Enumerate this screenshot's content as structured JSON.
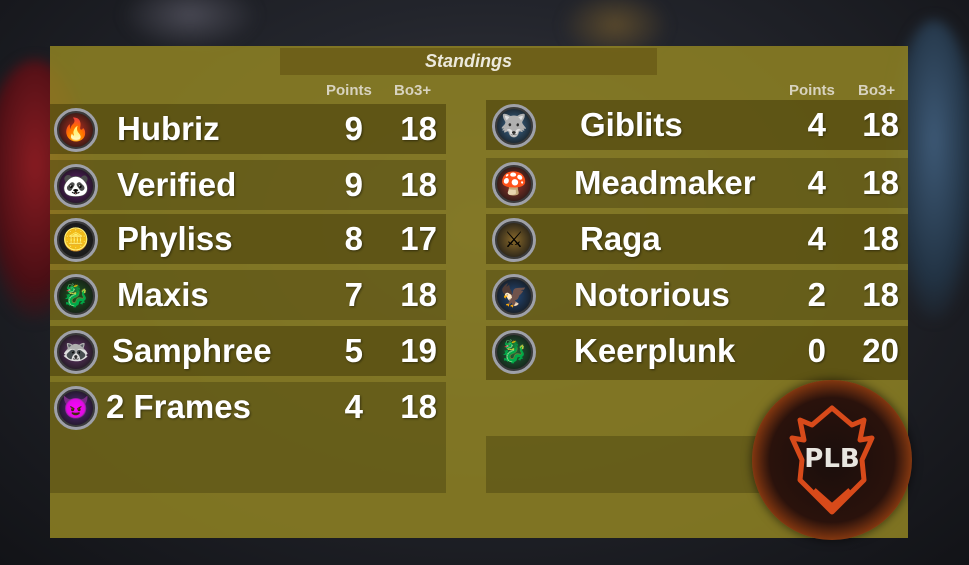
{
  "title": "Standings",
  "columns": {
    "points": "Points",
    "bo3": "Bo3+"
  },
  "left": [
    {
      "name": "Hubriz",
      "points": "9",
      "bo3": "18",
      "avatar_icon": "flame-icon",
      "color": "#c0301e"
    },
    {
      "name": "Verified",
      "points": "9",
      "bo3": "18",
      "avatar_icon": "panda-icon",
      "color": "#6a1f7a"
    },
    {
      "name": "Phyliss",
      "points": "8",
      "bo3": "17",
      "avatar_icon": "coins-icon",
      "color": "#2a2a2a"
    },
    {
      "name": "Maxis",
      "points": "7",
      "bo3": "18",
      "avatar_icon": "dragon-icon",
      "color": "#1f5a22"
    },
    {
      "name": "Samphree",
      "points": "5",
      "bo3": "19",
      "avatar_icon": "raccoon-icon",
      "color": "#6b3a72"
    },
    {
      "name": "2 Frames",
      "points": "4",
      "bo3": "18",
      "avatar_icon": "demon-icon",
      "color": "#5b2a88"
    }
  ],
  "right": [
    {
      "name": "Giblits",
      "points": "4",
      "bo3": "18",
      "avatar_icon": "wolf-icon",
      "color": "#3d6f9a"
    },
    {
      "name": "Meadmaker",
      "points": "4",
      "bo3": "18",
      "avatar_icon": "mushroom-icon",
      "color": "#a0382a"
    },
    {
      "name": "Raga",
      "points": "4",
      "bo3": "18",
      "avatar_icon": "knight-icon",
      "color": "#8a6a2a"
    },
    {
      "name": "Notorious",
      "points": "2",
      "bo3": "18",
      "avatar_icon": "eagle-icon",
      "color": "#244a7a"
    },
    {
      "name": "Keerplunk",
      "points": "0",
      "bo3": "20",
      "avatar_icon": "dragon-icon",
      "color": "#1f6a3a"
    }
  ],
  "logo": {
    "text": "PLB",
    "accent": "#d84a1a"
  }
}
